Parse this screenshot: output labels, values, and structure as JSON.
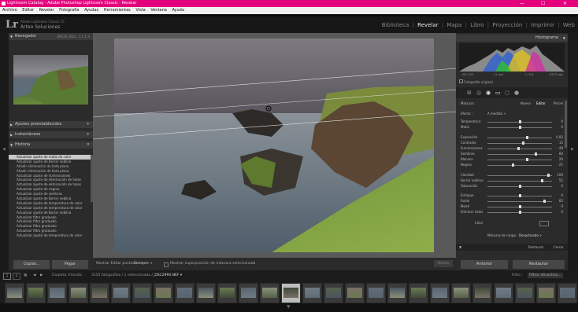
{
  "window": {
    "title": "Lightroom Catalog - Adobe Photoshop Lightroom Classic - Revelar",
    "controls": {
      "minimize": "—",
      "maximize": "☐",
      "close": "✕"
    }
  },
  "menu": [
    "Archivo",
    "Editar",
    "Revelar",
    "Fotografía",
    "Ayudas",
    "Herramientas",
    "Vista",
    "Ventana",
    "Ayuda"
  ],
  "header": {
    "logo": "Lr",
    "sub1": "Adobe Lightroom Classic CC",
    "sub2": "Arteo Soluciones",
    "modules": [
      "Biblioteca",
      "Revelar",
      "Mapa",
      "Libro",
      "Proyección",
      "Imprimir",
      "Web"
    ],
    "active_module": "Revelar"
  },
  "left": {
    "navigator": {
      "title": "Navegador",
      "tabs": "ENCAJ.  RELL.  1:1  1:4"
    },
    "presets": "Ajustes preestablecidos",
    "snapshots": "Instantáneas",
    "history": {
      "title": "Historia",
      "items": [
        "Actualizar ajuste de matiz de color",
        "Actualizar ajuste de Borrar neblina",
        "Añadir eliminación de tinta plana",
        "Añadir eliminación de tinta plana",
        "Actualizar ajuste de iluminaciones",
        "Actualizar ajuste de eliminación de halos",
        "Actualizar ajuste de eliminación de halos",
        "Actualizar ajuste de negros",
        "Actualizar ajuste de sombras",
        "Actualizar ajuste de Borrar neblina",
        "Actualizar ajuste de temperatura de color",
        "Actualizar ajuste de temperatura de color",
        "Actualizar ajuste de Borrar neblina",
        "Actualizar filtro graduado",
        "Actualizar filtro graduado",
        "Actualizar filtro graduado",
        "Actualizar filtro graduado",
        "Actualizar ajuste de temperatura de color"
      ]
    },
    "copy_button": "Copiar...",
    "paste_button": "Pegar"
  },
  "right": {
    "histogram": {
      "title": "Histograma",
      "info": [
        "ISO 100",
        "11 mm",
        "f / 5,6",
        "1/125 seg"
      ],
      "original": "Fotografía original"
    },
    "mask": {
      "label": "Máscara :",
      "new": "Nuevo",
      "edit": "Editar",
      "brush": "Pincel"
    },
    "effect": {
      "label": "Efecto :",
      "value": "A medida ÷"
    },
    "sliders": [
      {
        "name": "Temperatura",
        "pos": 0.5,
        "value": "0"
      },
      {
        "name": "Matiz",
        "pos": 0.5,
        "value": "0"
      },
      {
        "name": "Exposición",
        "pos": 0.62,
        "value": "0,92"
      },
      {
        "name": "Contraste",
        "pos": 0.55,
        "value": "15"
      },
      {
        "name": "Iluminaciones",
        "pos": 0.48,
        "value": "- 48"
      },
      {
        "name": "Sombras",
        "pos": 0.75,
        "value": "80"
      },
      {
        "name": "Blancos",
        "pos": 0.62,
        "value": "20"
      },
      {
        "name": "Negros",
        "pos": 0.4,
        "value": "- 25"
      },
      {
        "name": "Claridad",
        "pos": 0.95,
        "value": "100"
      },
      {
        "name": "Borrar neblina",
        "pos": 0.85,
        "value": "55"
      },
      {
        "name": "Saturación",
        "pos": 0.5,
        "value": "0"
      },
      {
        "name": "Enfoque",
        "pos": 0.5,
        "value": "0"
      },
      {
        "name": "Ruido",
        "pos": 0.88,
        "value": "85"
      },
      {
        "name": "Moiré",
        "pos": 0.5,
        "value": "0"
      },
      {
        "name": "Eliminar halos",
        "pos": 0.5,
        "value": "0"
      }
    ],
    "color_label": "Color",
    "range_mask": {
      "label": "Máscara de rango :",
      "value": "Desactivado ÷"
    },
    "reset": "Restaurar",
    "close": "Cerrar",
    "previous_button": "Anterior",
    "restore_button": "Restaurar"
  },
  "toolbar": {
    "show_pins_label": "Mostrar Editar puntos :",
    "show_pins_value": "Siempre ÷",
    "overlay_label": "Mostrar superposición de máscara seleccionada",
    "done": "Hecho"
  },
  "filmstrip_bar": {
    "pages": [
      "1",
      "2"
    ],
    "folder": "Carpeta: Irlandia",
    "count": "3155 fotografías / 1 seleccionada /",
    "file": "_DSC2994.NEF ▾",
    "filter_label": "Filtro :",
    "filter_value": "Filtros desactiva..."
  },
  "colors": {
    "title_bar": "#e4007c",
    "panel": "#2b2b2b",
    "canvas": "#595959"
  }
}
